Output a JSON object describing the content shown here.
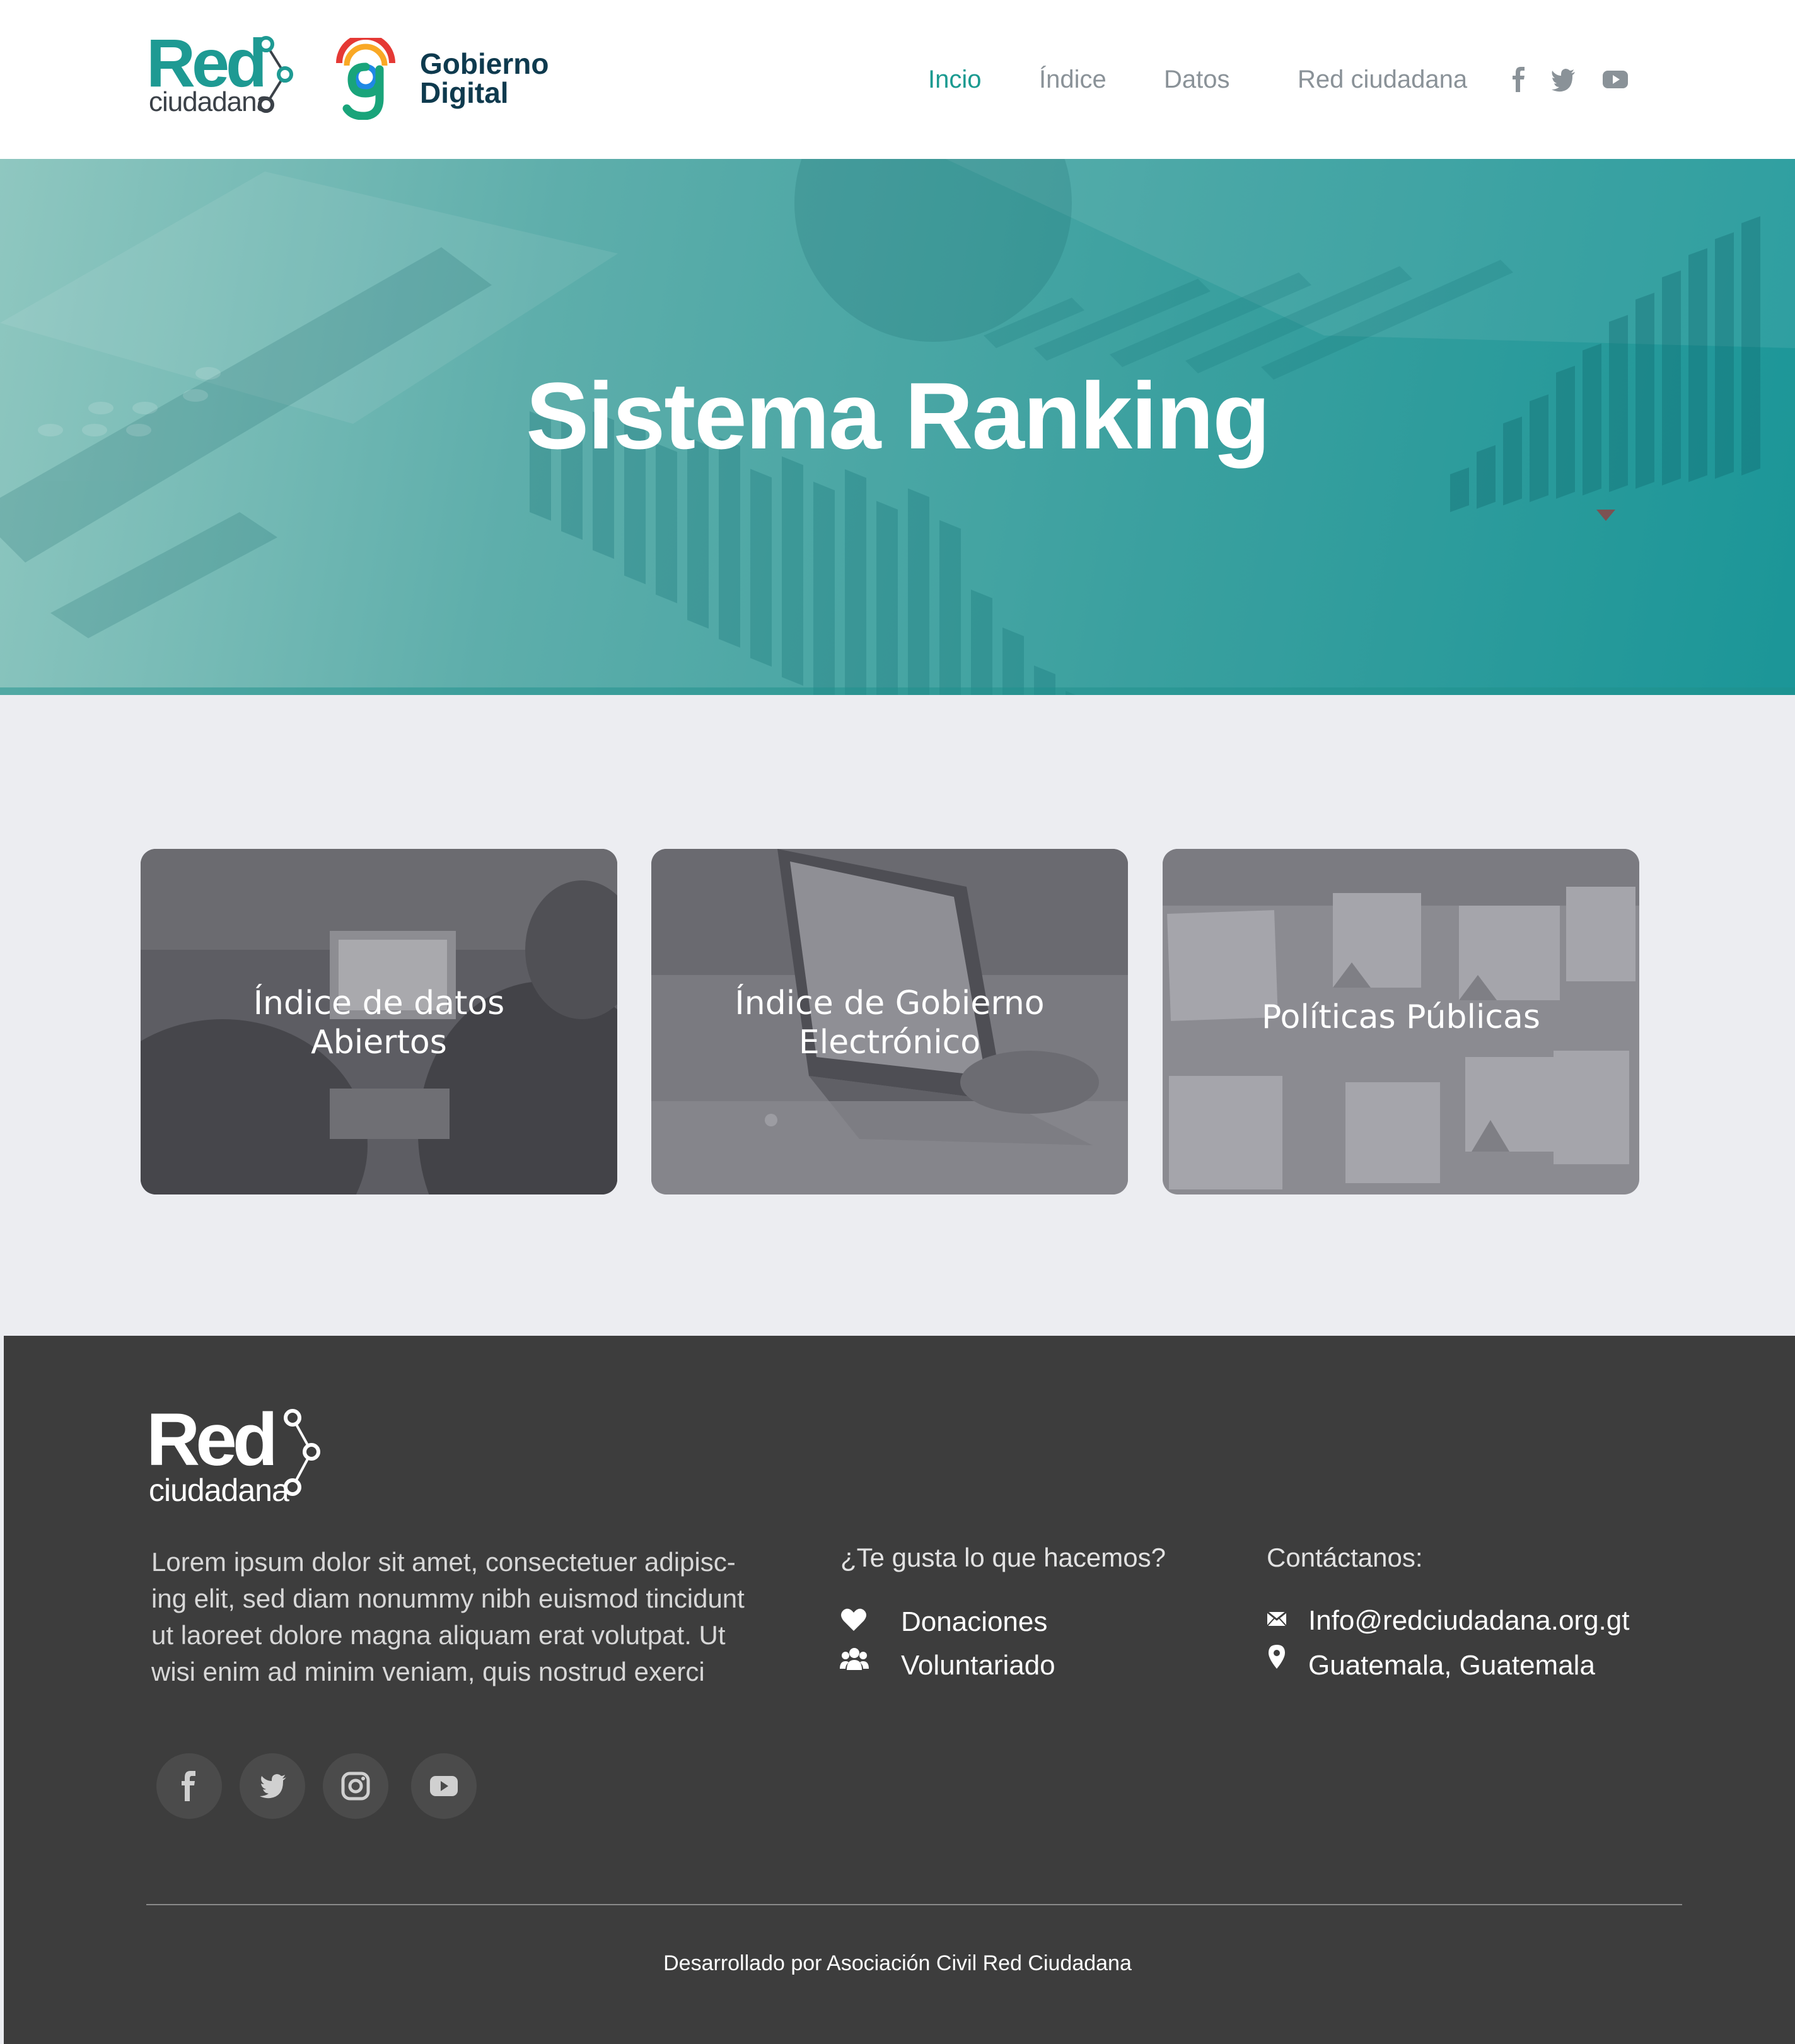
{
  "header": {
    "logo_red_word": "Red",
    "logo_red_sub": "ciudadana",
    "logo_gob_line1": "Gobierno",
    "logo_gob_line2": "Digital",
    "nav": [
      "Incio",
      "Índice",
      "Datos",
      "Red ciudadana"
    ],
    "active_nav": "Incio",
    "social_icons": [
      "facebook-icon",
      "twitter-icon",
      "youtube-icon"
    ]
  },
  "hero": {
    "title": "Sistema Ranking"
  },
  "cards": [
    {
      "line1": "Índice de datos",
      "line2": "Abiertos"
    },
    {
      "line1": "Índice de Gobierno",
      "line2": "Electrónico"
    },
    {
      "line1": "Políticas Públicas"
    }
  ],
  "footer": {
    "logo_word": "Red",
    "logo_sub": "ciudadana",
    "description": " Lorem ipsum dolor sit amet, consectetuer adipisc-ing elit, sed diam nonummy nibh euismod tincidunt ut laoreet dolore magna aliquam erat volutpat. Ut wisi enim ad minim veniam, quis nostrud exerci",
    "social_icons": [
      "facebook-icon",
      "twitter-icon",
      "instagram-icon",
      "youtube-icon"
    ],
    "support": {
      "heading": "¿Te gusta lo que hacemos?",
      "items": [
        "Donaciones",
        "Voluntariado"
      ]
    },
    "contact": {
      "heading": "Contáctanos:",
      "email": "Info@redciudadana.org.gt",
      "location": "Guatemala, Guatemala"
    },
    "credit": "Desarrollado por Asociación Civil Red Ciudadana"
  },
  "colors": {
    "brand_teal": "#1a9a90",
    "hero_start": "#8fc7c0",
    "hero_end": "#1b9698",
    "footer_bg": "#3d3d3d",
    "page_bg": "#ecedf1"
  }
}
